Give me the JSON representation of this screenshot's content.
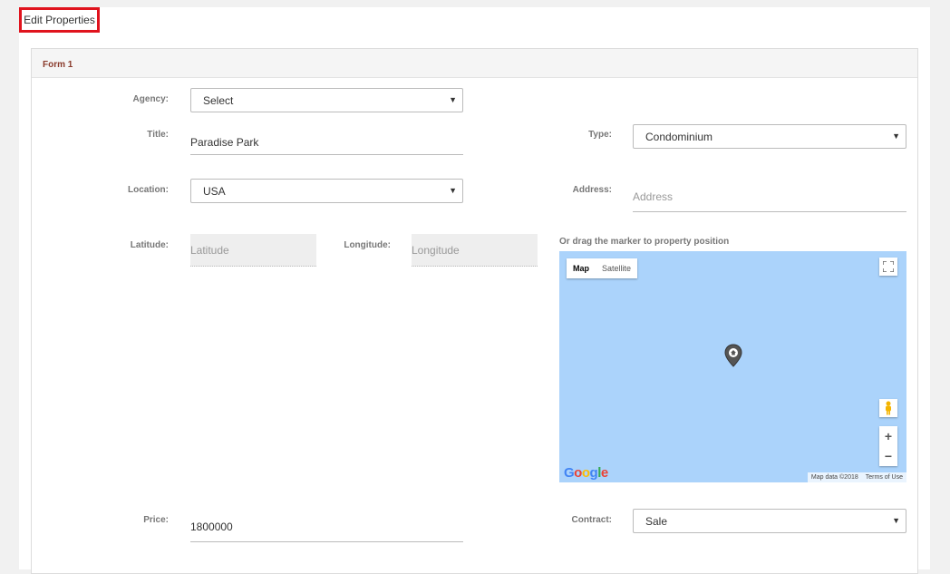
{
  "page": {
    "title": "Edit Properties"
  },
  "panel": {
    "title": "Form 1"
  },
  "form": {
    "agency": {
      "label": "Agency:",
      "value": "Select"
    },
    "title": {
      "label": "Title:",
      "value": "Paradise Park"
    },
    "type": {
      "label": "Type:",
      "value": "Condominium"
    },
    "location": {
      "label": "Location:",
      "value": "USA"
    },
    "address": {
      "label": "Address:",
      "placeholder": "Address"
    },
    "latitude": {
      "label": "Latitude:",
      "placeholder": "Latitude"
    },
    "longitude": {
      "label": "Longitude:",
      "placeholder": "Longitude"
    },
    "price": {
      "label": "Price:",
      "value": "1800000"
    },
    "contract": {
      "label": "Contract:",
      "value": "Sale"
    }
  },
  "map": {
    "caption": "Or drag the marker to property position",
    "type_map": "Map",
    "type_satellite": "Satellite",
    "zoom_in": "+",
    "zoom_out": "−",
    "logo": "Google",
    "attribution": "Map data ©2018",
    "terms": "Terms of Use",
    "water_color": "#abd3fb"
  },
  "colors": {
    "accent_border": "#e0131d",
    "panel_title": "#8a3b2c"
  }
}
